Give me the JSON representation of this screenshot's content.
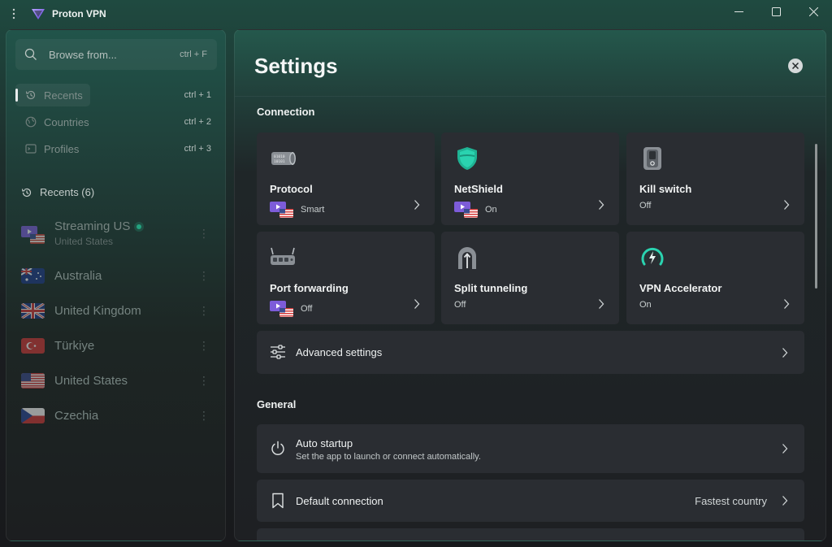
{
  "window": {
    "title": "Proton VPN"
  },
  "sidebar": {
    "search": {
      "placeholder": "Browse from...",
      "shortcut": "ctrl + F"
    },
    "nav": [
      {
        "label": "Recents",
        "shortcut": "ctrl + 1",
        "active": true
      },
      {
        "label": "Countries",
        "shortcut": "ctrl + 2",
        "active": false
      },
      {
        "label": "Profiles",
        "shortcut": "ctrl + 3",
        "active": false
      }
    ],
    "recents_heading": "Recents (6)",
    "recents": [
      {
        "name": "Streaming US",
        "sub": "United States",
        "online": true
      },
      {
        "name": "Australia"
      },
      {
        "name": "United Kingdom"
      },
      {
        "name": "Türkiye"
      },
      {
        "name": "United States"
      },
      {
        "name": "Czechia"
      }
    ]
  },
  "settings": {
    "title": "Settings",
    "connection_heading": "Connection",
    "cards": [
      {
        "title": "Protocol",
        "value": "Smart"
      },
      {
        "title": "NetShield",
        "value": "On"
      },
      {
        "title": "Kill switch",
        "value": "Off"
      },
      {
        "title": "Port forwarding",
        "value": "Off"
      },
      {
        "title": "Split tunneling",
        "value": "Off"
      },
      {
        "title": "VPN Accelerator",
        "value": "On"
      }
    ],
    "advanced": {
      "title": "Advanced settings"
    },
    "general_heading": "General",
    "auto_startup": {
      "title": "Auto startup",
      "subtitle": "Set the app to launch or connect automatically."
    },
    "default_connection": {
      "title": "Default connection",
      "value": "Fastest country"
    }
  },
  "colors": {
    "accent": "#24a380",
    "card": "#2a2d32",
    "netshield": "#2ad3b0"
  }
}
